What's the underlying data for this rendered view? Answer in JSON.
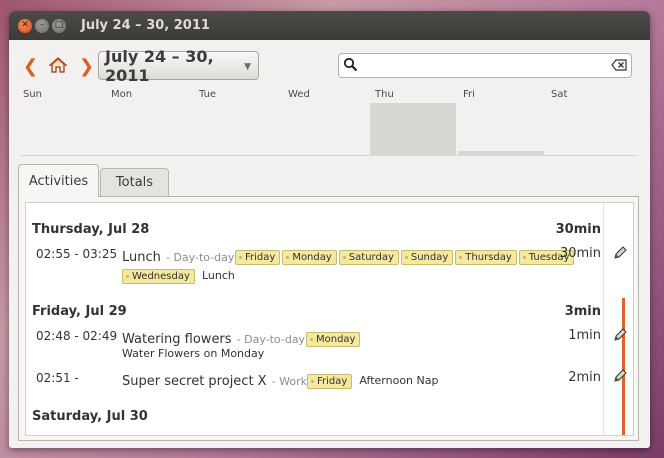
{
  "window": {
    "title": "July 24 – 30, 2011"
  },
  "toolbar": {
    "range_label": "July 24 – 30, 2011",
    "search_value": "",
    "search_placeholder": ""
  },
  "week_days": [
    "Sun",
    "Mon",
    "Tue",
    "Wed",
    "Thu",
    "Fri",
    "Sat"
  ],
  "day_bar_levels": [
    0,
    0,
    0,
    0,
    1.0,
    0.08,
    0
  ],
  "tabs": [
    {
      "label": "Activities",
      "active": true
    },
    {
      "label": "Totals",
      "active": false
    }
  ],
  "days": [
    {
      "heading": "Thursday, Jul 28",
      "total": "30min",
      "facts": [
        {
          "time": "02:55 - 03:25",
          "name": "Lunch",
          "category": "- Day-to-day",
          "tags": [
            "Friday",
            "Monday",
            "Saturday",
            "Sunday",
            "Thursday",
            "Tuesday",
            "Wednesday"
          ],
          "description": "Lunch",
          "duration": "30min"
        }
      ]
    },
    {
      "heading": "Friday, Jul 29",
      "total": "3min",
      "facts": [
        {
          "time": "02:48 - 02:49",
          "name": "Watering flowers",
          "category": "- Day-to-day",
          "tags": [
            "Monday"
          ],
          "description": "Water Flowers on Monday",
          "duration": "1min"
        },
        {
          "time": "02:51 -",
          "name": "Super secret project X",
          "category": "- Work",
          "tags": [
            "Friday"
          ],
          "description": "Afternoon Nap",
          "duration": "2min"
        }
      ]
    },
    {
      "heading": "Saturday, Jul 30",
      "total": "",
      "facts": []
    }
  ],
  "colors": {
    "accent": "#e4612a",
    "tag_bg": "#f5e89f",
    "titlebar": "#3c3b37"
  },
  "icons": [
    "close-icon",
    "minimize-icon",
    "maximize-icon",
    "back-arrow-icon",
    "home-icon",
    "forward-arrow-icon",
    "search-icon",
    "clear-icon",
    "pencil-icon"
  ]
}
